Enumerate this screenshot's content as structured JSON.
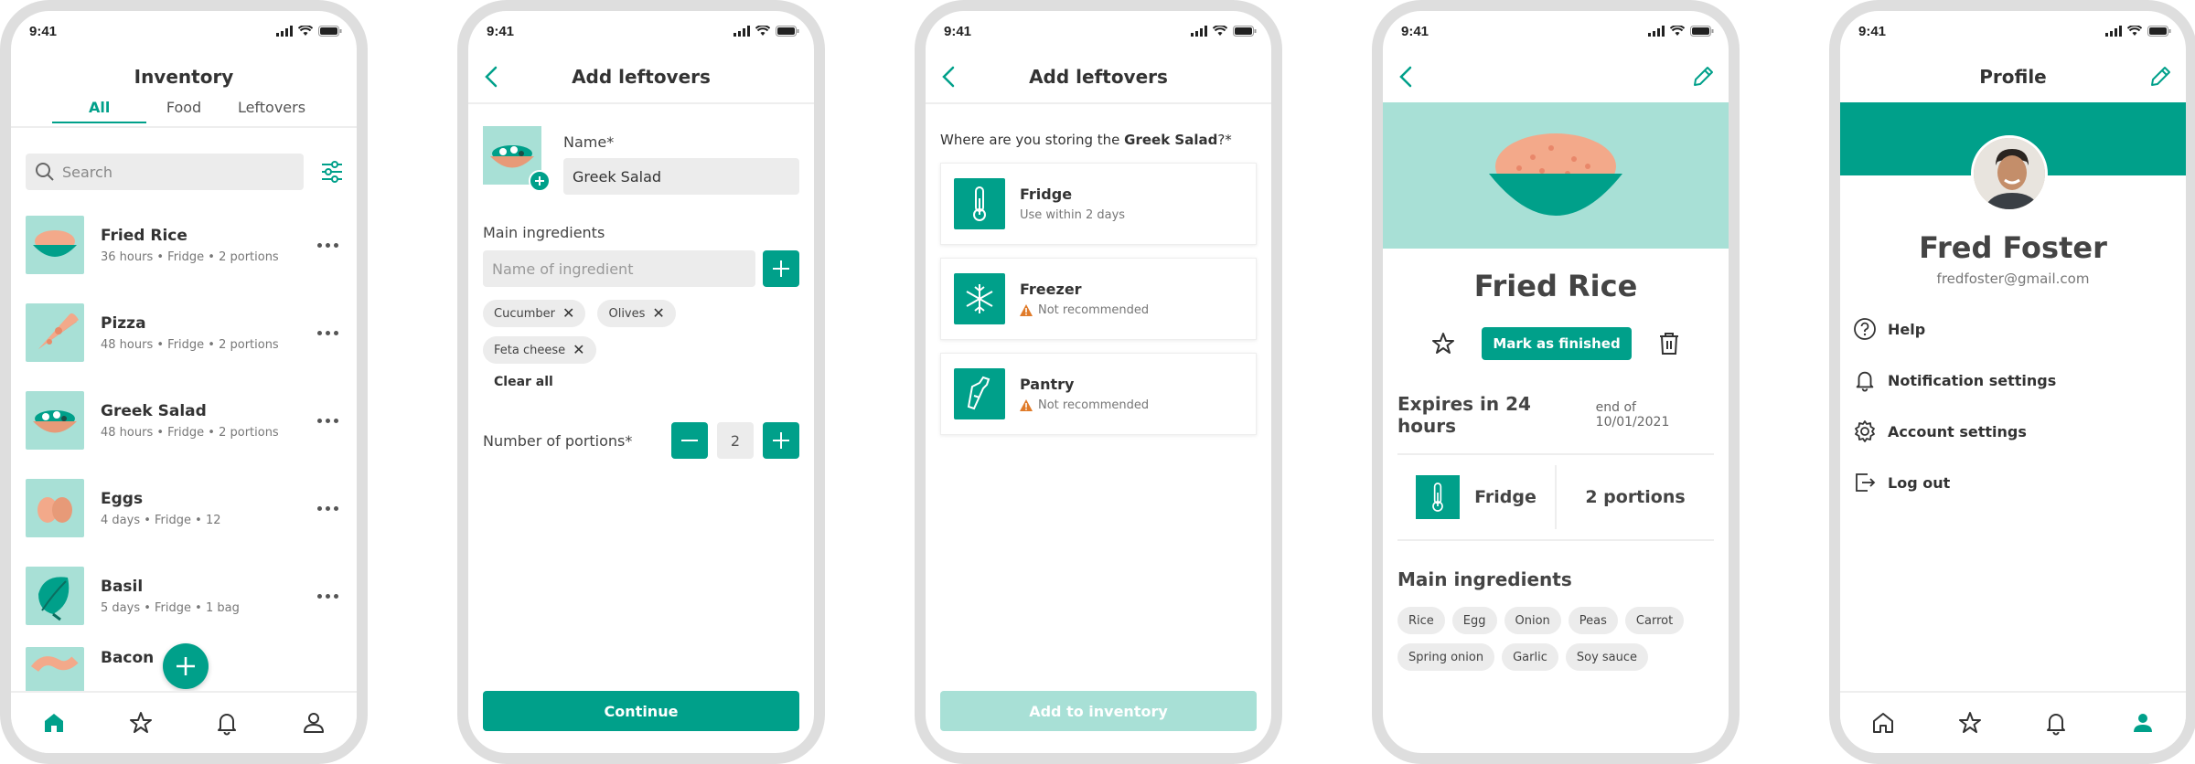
{
  "status": {
    "time": "9:41"
  },
  "inventory": {
    "title": "Inventory",
    "tabs": [
      "All",
      "Food",
      "Leftovers"
    ],
    "search_placeholder": "Search",
    "items": [
      {
        "name": "Fried Rice",
        "meta": "36 hours • Fridge • 2 portions"
      },
      {
        "name": "Pizza",
        "meta": "48 hours • Fridge • 2 portions"
      },
      {
        "name": "Greek Salad",
        "meta": "48 hours • Fridge • 2 portions"
      },
      {
        "name": "Eggs",
        "meta": "4 days • Fridge • 12"
      },
      {
        "name": "Basil",
        "meta": "5 days • Fridge • 1 bag"
      },
      {
        "name": "Bacon",
        "meta": ""
      }
    ]
  },
  "add_leftovers": {
    "title": "Add leftovers",
    "name_label": "Name*",
    "name_value": "Greek Salad",
    "ingredients_label": "Main ingredients",
    "ingredient_placeholder": "Name of ingredient",
    "chips": [
      "Cucumber",
      "Olives",
      "Feta cheese"
    ],
    "clear_all": "Clear all",
    "portions_label": "Number of portions*",
    "portions_value": "2",
    "continue": "Continue"
  },
  "storage": {
    "title": "Add leftovers",
    "question_prefix": "Where are you storing the ",
    "question_item": "Greek Salad",
    "question_suffix": "?*",
    "options": [
      {
        "name": "Fridge",
        "sub": "Use within 2 days",
        "warning": false
      },
      {
        "name": "Freezer",
        "sub": "Not recommended",
        "warning": true
      },
      {
        "name": "Pantry",
        "sub": "Not recommended",
        "warning": true
      }
    ],
    "add_button": "Add to inventory"
  },
  "detail": {
    "title": "Fried Rice",
    "finish_button": "Mark as finished",
    "expires": "Expires in 24 hours",
    "expires_date": "end of 10/01/2021",
    "location": "Fridge",
    "portions": "2 portions",
    "ingredients_title": "Main ingredients",
    "ingredients": [
      "Rice",
      "Egg",
      "Onion",
      "Peas",
      "Carrot",
      "Spring onion",
      "Garlic",
      "Soy sauce"
    ]
  },
  "profile": {
    "title": "Profile",
    "name": "Fred Foster",
    "email": "fredfoster@gmail.com",
    "menu": [
      "Help",
      "Notification settings",
      "Account settings",
      "Log out"
    ]
  },
  "colors": {
    "accent": "#00a08a",
    "accent_light": "#a8e0d6",
    "warning": "#e07b2a"
  }
}
